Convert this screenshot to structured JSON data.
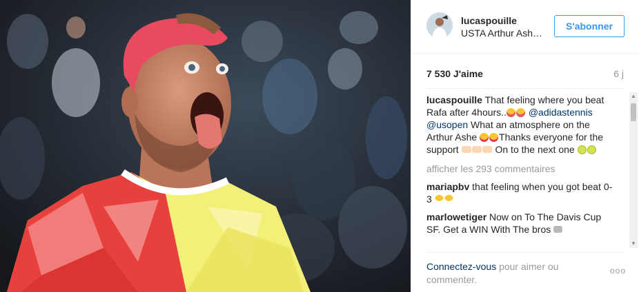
{
  "post": {
    "username": "lucaspouille",
    "location": "USTA Arthur Ashe Stadium",
    "follow_label": "S'abonner",
    "likes": "7 530 J'aime",
    "age": "6 j"
  },
  "caption": {
    "user": "lucaspouille",
    "text_1": "That feeling where you beat Rafa after 4hours..",
    "mention_1": "@adidastennis",
    "mention_2": "@usopen",
    "text_2": "What an atmosphere on the Arthur Ashe",
    "text_3": "Thanks everyone for the support",
    "text_4": "On to the next one"
  },
  "comments": {
    "more_label": "afficher les 293 commentaires",
    "items": [
      {
        "user": "mariapbv",
        "text": "that feeling when you got beat 0-3"
      },
      {
        "user": "marlowetiger",
        "text": "Now on To The Davis Cup SF. Get a WIN With The bros"
      }
    ]
  },
  "footer": {
    "login_label": "Connectez-vous",
    "suffix": "pour aimer ou commenter.",
    "options_label": "ooo"
  },
  "colors": {
    "accent": "#3897f0",
    "link": "#003569",
    "muted": "#999999",
    "cap": "#e84a5f",
    "shirt_red": "#e8413d",
    "shirt_yellow": "#f3f07a"
  },
  "icons": [
    "options-icon",
    "scroll-up-icon",
    "scroll-down-icon"
  ]
}
